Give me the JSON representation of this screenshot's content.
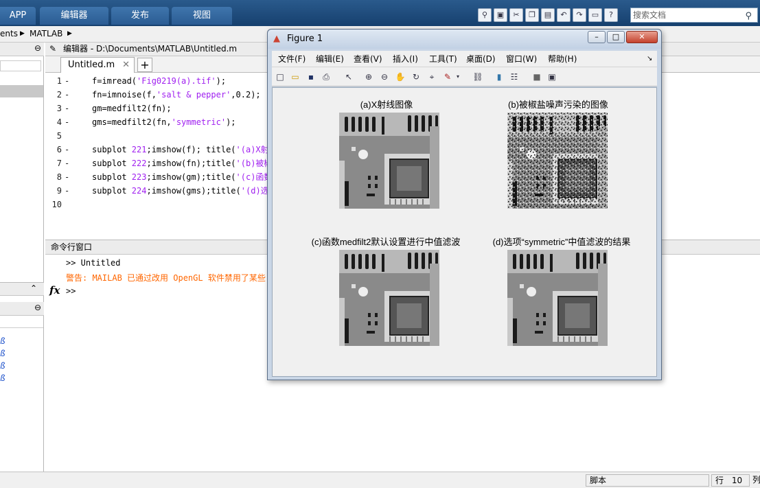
{
  "toolstrip": {
    "tabs": [
      "APP",
      "编辑器",
      "发布",
      "视图"
    ],
    "search_placeholder": "搜索文档"
  },
  "address": {
    "segments": [
      "ents",
      "MATLAB"
    ]
  },
  "editor": {
    "header": "编辑器 - D:\\Documents\\MATLAB\\Untitled.m",
    "tab_label": "Untitled.m",
    "lines": [
      {
        "n": "1",
        "pre": "f=imread(",
        "str": "'Fig0219(a).tif'",
        "post": ");"
      },
      {
        "n": "2",
        "pre": "fn=imnoise(f,",
        "str": "'salt & pepper'",
        "post": ",0.2);"
      },
      {
        "n": "3",
        "pre": "gm=medfilt2(fn);",
        "str": "",
        "post": ""
      },
      {
        "n": "4",
        "pre": "gms=medfilt2(fn,",
        "str": "'symmetric'",
        "post": ");"
      },
      {
        "n": "5",
        "pre": "",
        "str": "",
        "post": ""
      },
      {
        "n": "6",
        "pre": "subplot ",
        "str": "221",
        "post": ";imshow(f); title(",
        "tail": "'(a)X射约"
      },
      {
        "n": "7",
        "pre": "subplot ",
        "str": "222",
        "post": ";imshow(fn);title(",
        "tail": "'(b)被椒"
      },
      {
        "n": "8",
        "pre": "subplot ",
        "str": "223",
        "post": ";imshow(gm);title(",
        "tail": "'(c)函数"
      },
      {
        "n": "9",
        "pre": "subplot ",
        "str": "224",
        "post": ";imshow(gms);title(",
        "tail": "'(d)选巧"
      },
      {
        "n": "10",
        "pre": "",
        "str": "",
        "post": ""
      }
    ]
  },
  "command_window": {
    "title": "命令行窗口",
    "line1": ">> Untitled",
    "warning": "警告: MAILAB 已通过改用 OpenGL 软件禁用了某些",
    "prompt": ">>",
    "fx": "fx"
  },
  "status": {
    "mode": "脚本",
    "row_label": "行",
    "row_value": "10",
    "col_label": "列"
  },
  "figure": {
    "title": "Figure 1",
    "menu": [
      "文件(F)",
      "编辑(E)",
      "查看(V)",
      "插入(I)",
      "工具(T)",
      "桌面(D)",
      "窗口(W)",
      "帮助(H)"
    ],
    "subplot_titles": [
      "(a)X射线图像",
      "(b)被椒盐噪声污染的图像",
      "(c)函数medfilt2默认设置进行中值滤波",
      "(d)选项“symmetric”中值滤波的结果"
    ]
  },
  "colors": {
    "toolstrip": "#1f4f80",
    "string": "#a020f0",
    "warning": "#ff6600"
  }
}
